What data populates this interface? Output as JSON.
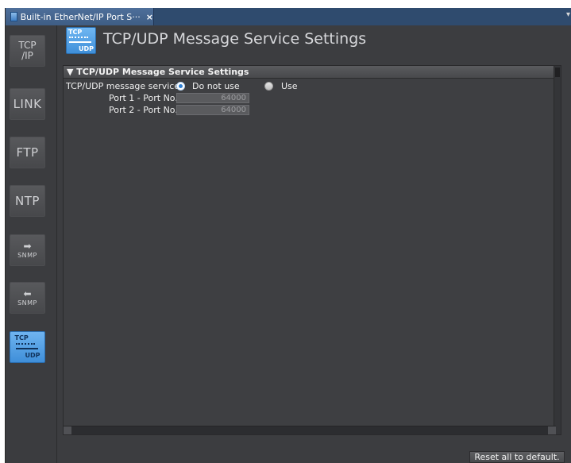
{
  "tab": {
    "label": "Built-in EtherNet/IP Port S···",
    "close": "×",
    "overflow": "▾"
  },
  "rail": {
    "items": [
      {
        "name": "tcpip",
        "line1": "TCP",
        "line2": "/IP"
      },
      {
        "name": "link",
        "text": "LINK"
      },
      {
        "name": "ftp",
        "text": "FTP"
      },
      {
        "name": "ntp",
        "text": "NTP"
      },
      {
        "name": "snmp-send",
        "arrow": "➡",
        "text": "SNMP"
      },
      {
        "name": "snmp-recv",
        "arrow": "⬅",
        "text": "SNMP"
      },
      {
        "name": "tcpudp",
        "top": "TCP",
        "bottom": "UDP"
      }
    ]
  },
  "header": {
    "icon_top": "TCP",
    "icon_bottom": "UDP",
    "title": "TCP/UDP Message Service Settings"
  },
  "section": {
    "title": "▼ TCP/UDP Message Service Settings"
  },
  "form": {
    "service_label": "TCP/UDP message service",
    "options": [
      {
        "label": "Do not use",
        "selected": true
      },
      {
        "label": "Use",
        "selected": false
      }
    ],
    "port1_label": "Port 1 - Port No.",
    "port1_value": "64000",
    "port2_label": "Port 2 - Port No.",
    "port2_value": "64000"
  },
  "footer": {
    "reset_label": "Reset all to default."
  },
  "colors": {
    "background": "#3c3d40",
    "accent": "#3f8fd9",
    "tab": "#3e5d85"
  }
}
